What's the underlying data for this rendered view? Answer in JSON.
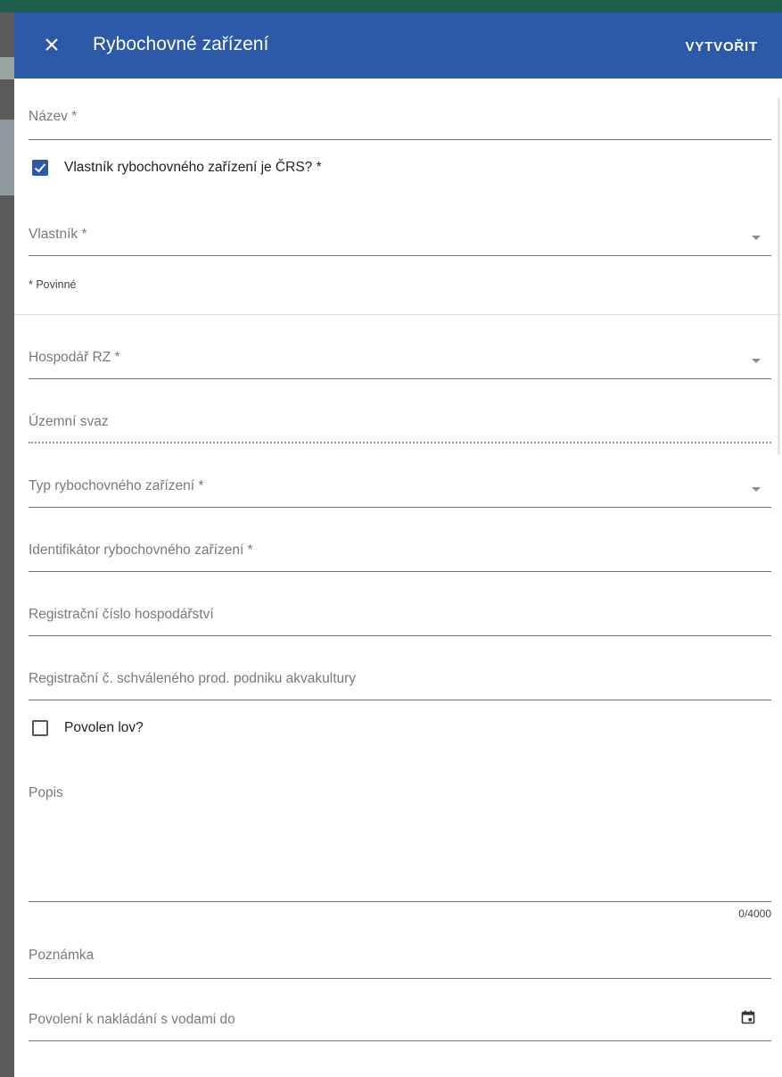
{
  "dialog": {
    "title": "Rybochovné zařízení",
    "create_label": "VYTVOŘIT",
    "close_icon": "close-icon"
  },
  "form": {
    "nazev": {
      "label": "Název *"
    },
    "vlastnik_crs": {
      "label": "Vlastník rybochovného zařízení je ČRS? *",
      "checked": true
    },
    "vlastnik": {
      "label": "Vlastník *"
    },
    "required_note": "* Povinné",
    "hospodar": {
      "label": "Hospodář RZ *"
    },
    "uzemni_svaz": {
      "label": "Územní svaz"
    },
    "typ": {
      "label": "Typ rybochovného zařízení *"
    },
    "identifikator": {
      "label": "Identifikátor rybochovného zařízení *"
    },
    "reg_cislo": {
      "label": "Registrační číslo hospodářství"
    },
    "reg_schvaleny": {
      "label": "Registrační č. schváleného prod. podniku akvakultury"
    },
    "povolen_lov": {
      "label": "Povolen lov?",
      "checked": false
    },
    "popis": {
      "label": "Popis",
      "counter": "0/4000"
    },
    "poznamka": {
      "label": "Poznámka"
    },
    "povoleni": {
      "label": "Povolení k nakládání s vodami do",
      "icon": "calendar-icon"
    }
  },
  "colors": {
    "primary": "#2c5aa8",
    "header_text": "#ffffff"
  }
}
